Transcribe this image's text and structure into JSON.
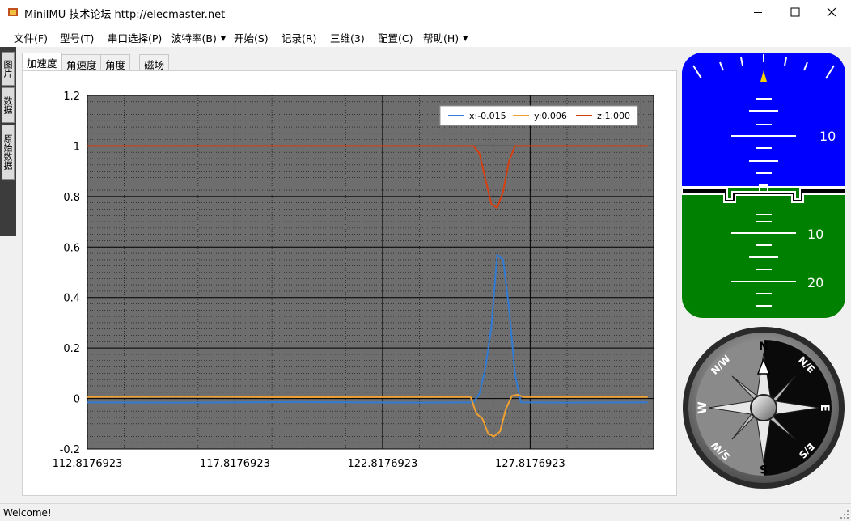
{
  "window": {
    "title": "MiniIMU 技术论坛 http://elecmaster.net"
  },
  "menu": [
    {
      "label": "文件(F)",
      "dropdown": false
    },
    {
      "label": "型号(T)",
      "dropdown": false
    },
    {
      "label": "串口选择(P)",
      "dropdown": false
    },
    {
      "label": "波特率(B)",
      "dropdown": true
    },
    {
      "label": "开始(S)",
      "dropdown": false
    },
    {
      "label": "记录(R)",
      "dropdown": false
    },
    {
      "label": "三维(3)",
      "dropdown": false
    },
    {
      "label": "配置(C)",
      "dropdown": false
    },
    {
      "label": "帮助(H)",
      "dropdown": true
    }
  ],
  "side_tabs": [
    "图片",
    "数据",
    "原始数据"
  ],
  "tabs": [
    "加速度",
    "角速度",
    "角度",
    "磁场"
  ],
  "active_tab": 0,
  "status": {
    "text": "Welcome!"
  },
  "colors": {
    "plot_bg": "#6e6e6e",
    "x_series": "#2f7bd6",
    "y_series": "#f0a030",
    "z_series": "#d63f10",
    "sky": "#0000ff",
    "ground": "#008000"
  },
  "chart_data": {
    "type": "line",
    "ylim": [
      -0.2,
      1.2
    ],
    "xlim": [
      112.8176923,
      132.0
    ],
    "yticks": [
      "1.2",
      "1",
      "0.8",
      "0.6",
      "0.4",
      "0.2",
      "0",
      "-0.2"
    ],
    "ytick_values": [
      1.2,
      1.0,
      0.8,
      0.6,
      0.4,
      0.2,
      0.0,
      -0.2
    ],
    "xticks": [
      "112.8176923",
      "117.8176923",
      "122.8176923",
      "127.8176923"
    ],
    "xtick_values": [
      112.8176923,
      117.8176923,
      122.8176923,
      127.8176923
    ],
    "grid": true,
    "legend_position": "top-right",
    "series": [
      {
        "name": "x:-0.015",
        "color_key": "x_series",
        "points": [
          [
            112.8,
            -0.015
          ],
          [
            116.0,
            -0.016
          ],
          [
            120.0,
            -0.014
          ],
          [
            124.0,
            -0.016
          ],
          [
            125.9,
            -0.015
          ],
          [
            126.1,
            0.02
          ],
          [
            126.3,
            0.12
          ],
          [
            126.5,
            0.28
          ],
          [
            126.7,
            0.57
          ],
          [
            126.9,
            0.55
          ],
          [
            127.1,
            0.36
          ],
          [
            127.3,
            0.1
          ],
          [
            127.5,
            -0.015
          ],
          [
            129.0,
            -0.016
          ],
          [
            131.8,
            -0.015
          ]
        ]
      },
      {
        "name": "y:0.006",
        "color_key": "y_series",
        "points": [
          [
            112.8,
            0.006
          ],
          [
            116.0,
            0.007
          ],
          [
            120.0,
            0.005
          ],
          [
            124.0,
            0.006
          ],
          [
            125.8,
            0.006
          ],
          [
            126.0,
            -0.06
          ],
          [
            126.2,
            -0.08
          ],
          [
            126.4,
            -0.14
          ],
          [
            126.6,
            -0.15
          ],
          [
            126.8,
            -0.13
          ],
          [
            127.0,
            -0.04
          ],
          [
            127.2,
            0.01
          ],
          [
            127.4,
            0.015
          ],
          [
            127.6,
            0.006
          ],
          [
            131.8,
            0.006
          ]
        ]
      },
      {
        "name": "z:1.000",
        "color_key": "z_series",
        "points": [
          [
            112.8,
            1.0
          ],
          [
            116.0,
            1.0
          ],
          [
            120.0,
            1.0
          ],
          [
            124.0,
            1.0
          ],
          [
            125.9,
            1.0
          ],
          [
            126.1,
            0.97
          ],
          [
            126.3,
            0.87
          ],
          [
            126.5,
            0.77
          ],
          [
            126.7,
            0.755
          ],
          [
            126.9,
            0.82
          ],
          [
            127.1,
            0.94
          ],
          [
            127.3,
            1.0
          ],
          [
            131.8,
            1.0
          ]
        ]
      }
    ]
  },
  "attitude_indicator": {
    "pitch_labels": [
      "10",
      "10",
      "20"
    ]
  },
  "compass": {
    "labels": [
      "N",
      "N/E",
      "E",
      "E/S",
      "S",
      "S/W",
      "W",
      "N/W"
    ]
  }
}
